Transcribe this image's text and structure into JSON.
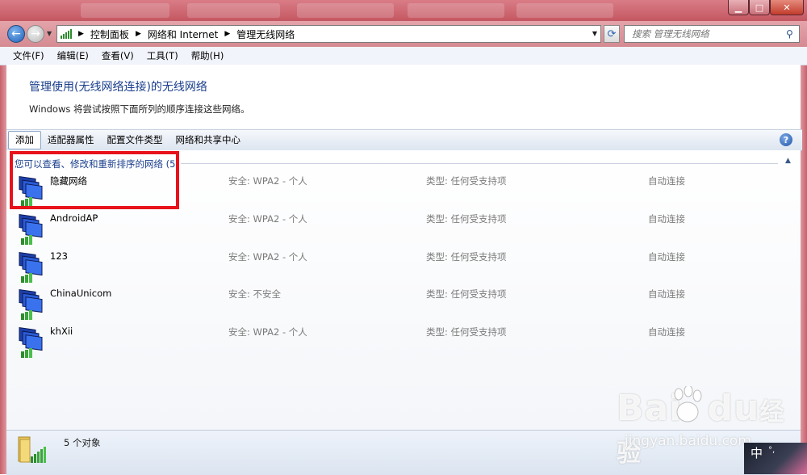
{
  "window": {
    "minimize_glyph": "▁",
    "maximize_glyph": "□",
    "close_glyph": "✕"
  },
  "navigation": {
    "back_icon": "back-arrow-icon",
    "forward_icon": "forward-arrow-icon",
    "breadcrumb": [
      "控制面板",
      "网络和 Internet",
      "管理无线网络"
    ],
    "breadcrumb_separator": "▶",
    "search_placeholder": "搜索 管理无线网络"
  },
  "menu": [
    "文件(F)",
    "编辑(E)",
    "查看(V)",
    "工具(T)",
    "帮助(H)"
  ],
  "header": {
    "title": "管理使用(无线网络连接)的无线网络",
    "description": "Windows 将尝试按照下面所列的顺序连接这些网络。"
  },
  "toolbar": {
    "buttons": [
      "添加",
      "适配器属性",
      "配置文件类型",
      "网络和共享中心"
    ],
    "help_glyph": "?"
  },
  "group_label": "您可以查看、修改和重新排序的网络 (5)",
  "networks": [
    {
      "name": "隐藏网络",
      "security": "安全: WPA2 - 个人",
      "type": "类型: 任何受支持项",
      "connect": "自动连接"
    },
    {
      "name": "AndroidAP",
      "security": "安全: WPA2 - 个人",
      "type": "类型: 任何受支持项",
      "connect": "自动连接"
    },
    {
      "name": "123",
      "security": "安全: WPA2 - 个人",
      "type": "类型: 任何受支持项",
      "connect": "自动连接"
    },
    {
      "name": "ChinaUnicom",
      "security": "安全: 不安全",
      "type": "类型: 任何受支持项",
      "connect": "自动连接"
    },
    {
      "name": "khXii",
      "security": "安全: WPA2 - 个人",
      "type": "类型: 任何受支持项",
      "connect": "自动连接"
    }
  ],
  "status": {
    "text": "5 个对象"
  },
  "watermark": {
    "brand_prefix": "Bai",
    "brand_suffix": "du",
    "brand_cn": "经验",
    "url": "jingyan.baidu.com"
  },
  "ime": {
    "label": "中",
    "sub": "°,"
  },
  "colors": {
    "titlebar": "#c45761",
    "link_blue": "#1a3e8c",
    "highlight_red": "#e8121a",
    "signal_green": "#2d8c2d"
  }
}
